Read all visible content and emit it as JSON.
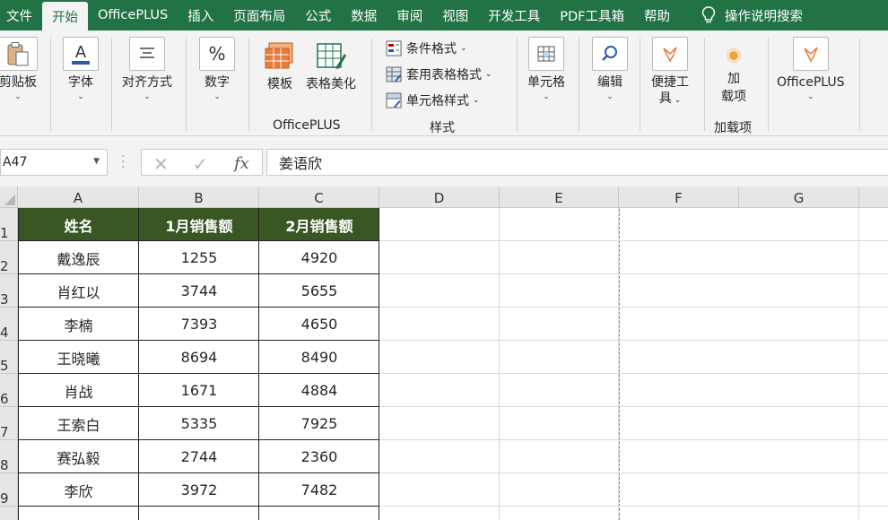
{
  "tabs": [
    "文件",
    "开始",
    "OfficePLUS",
    "插入",
    "页面布局",
    "公式",
    "数据",
    "审阅",
    "视图",
    "开发工具",
    "PDF工具箱",
    "帮助"
  ],
  "active_tab": "开始",
  "tell_me": "操作说明搜索",
  "ribbon": {
    "clipboard": "剪贴板",
    "font": "字体",
    "align": "对齐方式",
    "number": "数字",
    "template": "模板",
    "beautify": "表格美化",
    "officeplus_group": "OfficePLUS",
    "cond_format": "条件格式",
    "table_format": "套用表格格式",
    "cell_style": "单元格样式",
    "style_group": "样式",
    "cells": "单元格",
    "edit": "编辑",
    "tools_line1": "便捷工",
    "tools_line2": "具",
    "addin_line1": "加",
    "addin_line2": "载项",
    "addin_group": "加载项",
    "officeplus_btn": "OfficePLUS",
    "number_symbol": "%",
    "font_symbol": "A"
  },
  "formula_bar": {
    "name_box": "A47",
    "fx": "fx",
    "cancel": "✕",
    "confirm": "✓",
    "content": "姜语欣"
  },
  "sheet": {
    "columns": [
      "A",
      "B",
      "C",
      "D",
      "E",
      "F",
      "G"
    ],
    "row_numbers": [
      "1",
      "2",
      "3",
      "4",
      "5",
      "6",
      "7",
      "8",
      "9"
    ],
    "header": [
      "姓名",
      "1月销售额",
      "2月销售额"
    ],
    "rows": [
      [
        "戴逸辰",
        "1255",
        "4920"
      ],
      [
        "肖红以",
        "3744",
        "5655"
      ],
      [
        "李楠",
        "7393",
        "4650"
      ],
      [
        "王晓曦",
        "8694",
        "8490"
      ],
      [
        "肖战",
        "1671",
        "4884"
      ],
      [
        "王索白",
        "5335",
        "7925"
      ],
      [
        "赛弘毅",
        "2744",
        "2360"
      ],
      [
        "李欣",
        "3972",
        "7482"
      ]
    ],
    "header_color": "#385723"
  },
  "colors": {
    "brand": "#217346",
    "accent_orange": "#e97a3c"
  }
}
